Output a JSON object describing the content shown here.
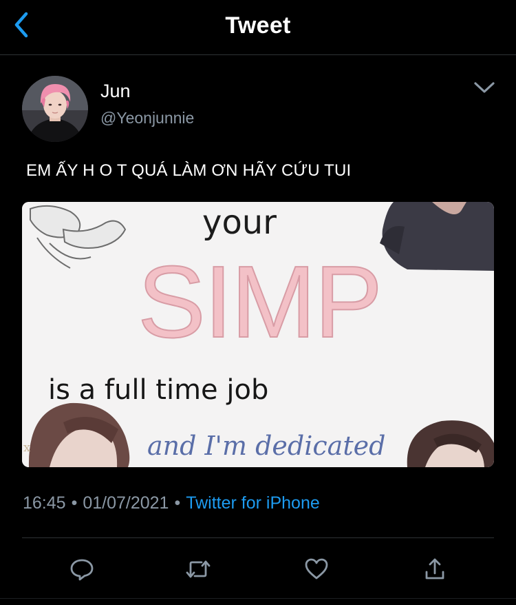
{
  "header": {
    "title": "Tweet",
    "back_icon": "chevron-left-icon"
  },
  "author": {
    "name": "Jun",
    "handle": "@Yeonjunnie",
    "avatar": "avatar-photo",
    "more_icon": "chevron-down-icon"
  },
  "tweet": {
    "text": "EM ẤY H O T QUÁ LÀM ƠN HÃY CỨU TUI",
    "media": {
      "line1": "your",
      "line2": "SIMP",
      "line3": "is a full time job",
      "line4": "and I'm dedicated"
    }
  },
  "meta": {
    "time": "16:45",
    "date": "01/07/2021",
    "separator": "•",
    "source": "Twitter for iPhone"
  },
  "actions": {
    "reply_icon": "reply-icon",
    "retweet_icon": "retweet-icon",
    "like_icon": "heart-icon",
    "share_icon": "share-icon"
  },
  "colors": {
    "background": "#000000",
    "accent": "#1d9bf0",
    "muted": "#8b98a5",
    "simp_pink": "#f2b8c0",
    "dedicated_blue": "#5a6ea8"
  }
}
